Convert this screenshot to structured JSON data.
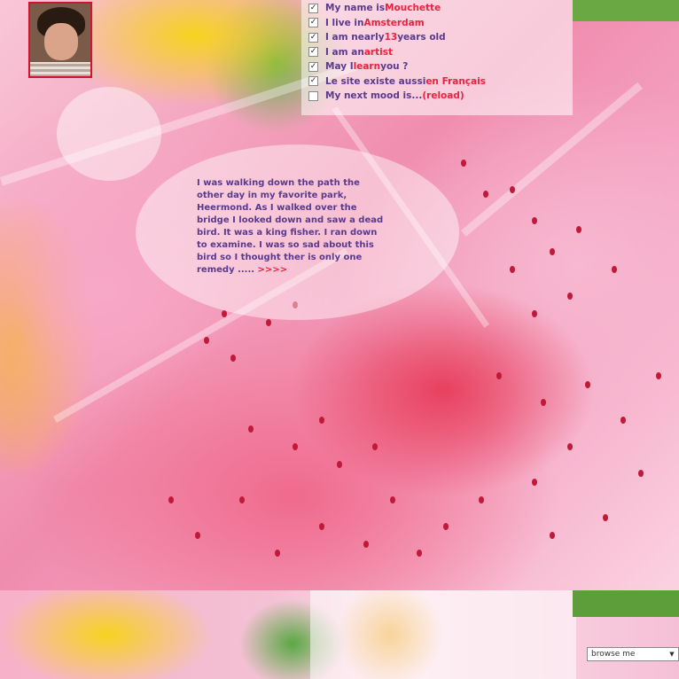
{
  "profile": {
    "items": [
      {
        "checked": true,
        "text": "My name is ",
        "highlight": "Mouchette",
        "suffix": ""
      },
      {
        "checked": true,
        "text": "I live in ",
        "highlight": "Amsterdam",
        "suffix": ""
      },
      {
        "checked": true,
        "text": "I am nearly ",
        "highlight": "13",
        "suffix": " years old"
      },
      {
        "checked": true,
        "text": "I am an ",
        "highlight": "artist",
        "suffix": ""
      },
      {
        "checked": true,
        "text": "May I ",
        "highlight": "learn",
        "suffix": " you ?"
      },
      {
        "checked": true,
        "text": "Le site existe aussi ",
        "highlight": "en Français",
        "suffix": ""
      },
      {
        "checked": false,
        "text": "My next mood is... ",
        "highlight": "(reload)",
        "suffix": ""
      }
    ]
  },
  "story": {
    "text": "I was walking down the path the other day in my favorite park, Heermond. As I walked over the bridge I looked down and saw a dead bird. It was a king fisher. I ran down to examine. I was so sad about this bird so I thought ther is only one remedy .....",
    "more_link": " >>>>"
  },
  "browse": {
    "selected": "browse me"
  },
  "colors": {
    "text": "#5a3a8c",
    "highlight": "#e8233f",
    "avatar_border": "#d3122d"
  }
}
